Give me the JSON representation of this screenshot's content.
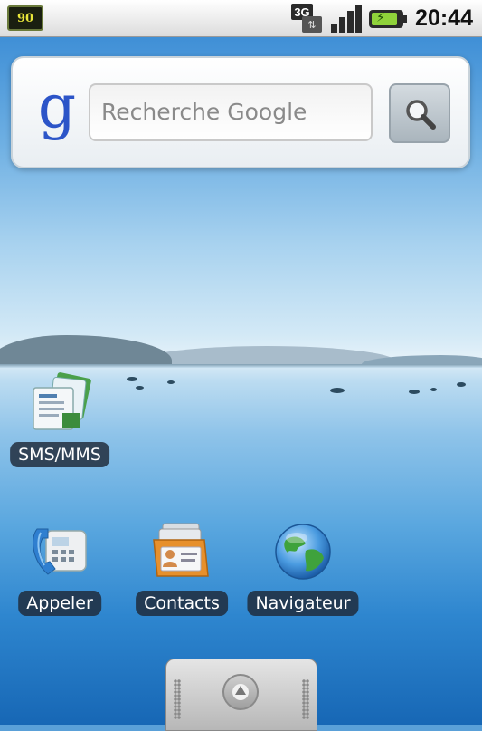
{
  "status_bar": {
    "notification_badge": "90",
    "network_type": "3G",
    "signal_icon": "signal-strength-icon",
    "battery_icon": "battery-charging-icon",
    "time": "20:44"
  },
  "search_widget": {
    "logo": "g",
    "placeholder": "Recherche Google",
    "button_icon": "magnifier-icon"
  },
  "apps": [
    {
      "label": "SMS/MMS",
      "icon": "messaging-icon"
    },
    {
      "label": "Appeler",
      "icon": "phone-icon"
    },
    {
      "label": "Contacts",
      "icon": "contacts-icon"
    },
    {
      "label": "Navigateur",
      "icon": "browser-globe-icon"
    }
  ],
  "dock": {
    "icon": "app-drawer-arrow-icon"
  }
}
